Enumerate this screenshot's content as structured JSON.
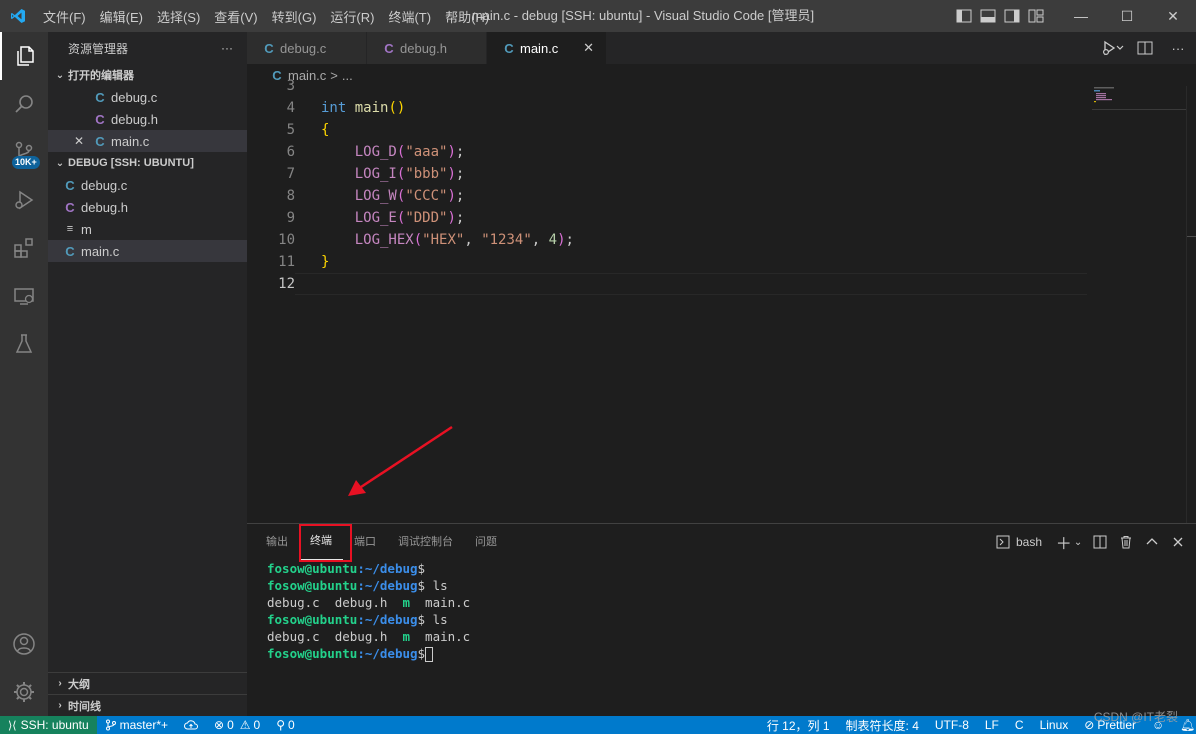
{
  "titlebar": {
    "menu": [
      "文件(F)",
      "编辑(E)",
      "选择(S)",
      "查看(V)",
      "转到(G)",
      "运行(R)",
      "终端(T)",
      "帮助(H)"
    ],
    "title": "main.c - debug [SSH: ubuntu] - Visual Studio Code [管理员]",
    "minimize": "—",
    "maximize": "☐",
    "close": "✕"
  },
  "activity": {
    "scm_badge": "10K+"
  },
  "sidebar": {
    "title": "资源管理器",
    "more": "···",
    "open_editors": {
      "label": "打开的编辑器",
      "items": [
        {
          "icon": "C",
          "name": "debug.c"
        },
        {
          "icon": "C",
          "name": "debug.h"
        },
        {
          "icon": "C",
          "name": "main.c",
          "close": "✕"
        }
      ]
    },
    "workspace": {
      "label": "DEBUG [SSH: UBUNTU]",
      "items": [
        {
          "icon": "C",
          "name": "debug.c"
        },
        {
          "icon": "C",
          "name": "debug.h"
        },
        {
          "icon": "≡",
          "name": "m"
        },
        {
          "icon": "C",
          "name": "main.c"
        }
      ]
    },
    "outline": "大纲",
    "timeline": "时间线"
  },
  "tabs": [
    {
      "icon": "C",
      "label": "debug.c"
    },
    {
      "icon": "C",
      "label": "debug.h"
    },
    {
      "icon": "C",
      "label": "main.c",
      "close": "✕"
    }
  ],
  "breadcrumb": {
    "file": "main.c",
    "sep": ">",
    "rest": "..."
  },
  "code": {
    "line_numbers": [
      "3",
      "4",
      "5",
      "6",
      "7",
      "8",
      "9",
      "10",
      "11",
      "12"
    ],
    "l4_kw": "int",
    "l4_fn": "main",
    "l4_paren": "()",
    "l5": "{",
    "l6_mac": "LOG_D",
    "l6_open": "(",
    "l6_str": "\"aaa\"",
    "l6_close": ")",
    "l6_semi": ";",
    "l7_mac": "LOG_I",
    "l7_open": "(",
    "l7_str": "\"bbb\"",
    "l7_close": ")",
    "l7_semi": ";",
    "l8_mac": "LOG_W",
    "l8_open": "(",
    "l8_str": "\"CCC\"",
    "l8_close": ")",
    "l8_semi": ";",
    "l9_mac": "LOG_E",
    "l9_open": "(",
    "l9_str": "\"DDD\"",
    "l9_close": ")",
    "l9_semi": ";",
    "l10_mac": "LOG_HEX",
    "l10_open": "(",
    "l10_str1": "\"HEX\"",
    "l10_comma1": ", ",
    "l10_str2": "\"1234\"",
    "l10_comma2": ", ",
    "l10_num": "4",
    "l10_close": ")",
    "l10_semi": ";",
    "l11": "}"
  },
  "panel": {
    "tabs": [
      "输出",
      "终端",
      "端口",
      "调试控制台",
      "问题"
    ],
    "active_tab": "终端",
    "shell": "bash",
    "terminal": [
      {
        "user": "fosow@ubuntu",
        "path": ":~/debug",
        "sym": "$",
        "cmd": ""
      },
      {
        "user": "fosow@ubuntu",
        "path": ":~/debug",
        "sym": "$",
        "cmd": " ls"
      },
      {
        "out": "debug.c  debug.h  ",
        "green": "m",
        "out2": "  main.c"
      },
      {
        "user": "fosow@ubuntu",
        "path": ":~/debug",
        "sym": "$",
        "cmd": " ls"
      },
      {
        "out": "debug.c  debug.h  ",
        "green": "m",
        "out2": "  main.c"
      },
      {
        "user": "fosow@ubuntu",
        "path": ":~/debug",
        "sym": "$",
        "cmd": " "
      }
    ]
  },
  "statusbar": {
    "remote": "SSH: ubuntu",
    "branch": "master*+",
    "errors": "0",
    "warnings": "0",
    "ports": "0",
    "position": "行 12，列 1",
    "indent": "制表符长度: 4",
    "encoding": "UTF-8",
    "eol": "LF",
    "language": "C",
    "os": "Linux",
    "prettier": "Prettier"
  },
  "watermark": "CSDN @IT老裂",
  "colors": {
    "accent": "#007acc",
    "remote": "#16825d",
    "highlight_box": "#e81123",
    "annotation_arrow": "#e81123"
  }
}
